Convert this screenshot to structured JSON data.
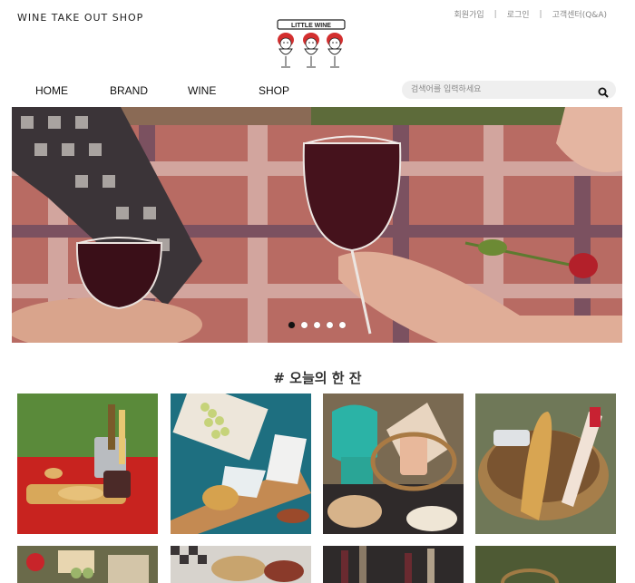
{
  "header": {
    "shop_name": "WINE TAKE OUT SHOP",
    "links": [
      "회원가입",
      "로그인",
      "고객센터(Q&A)"
    ],
    "logo_text": "LITTLE WINE"
  },
  "nav": {
    "items": [
      "HOME",
      "BRAND",
      "WINE",
      "SHOP"
    ]
  },
  "search": {
    "placeholder": "검색어를 입력하세요",
    "icon": "search-icon"
  },
  "hero": {
    "slide_count": 5,
    "active_slide": 1
  },
  "section": {
    "title": "# 오늘의 한 잔"
  },
  "colors": {
    "accent_red": "#c62828",
    "nav_text": "#111111",
    "search_bg": "#efefef"
  }
}
